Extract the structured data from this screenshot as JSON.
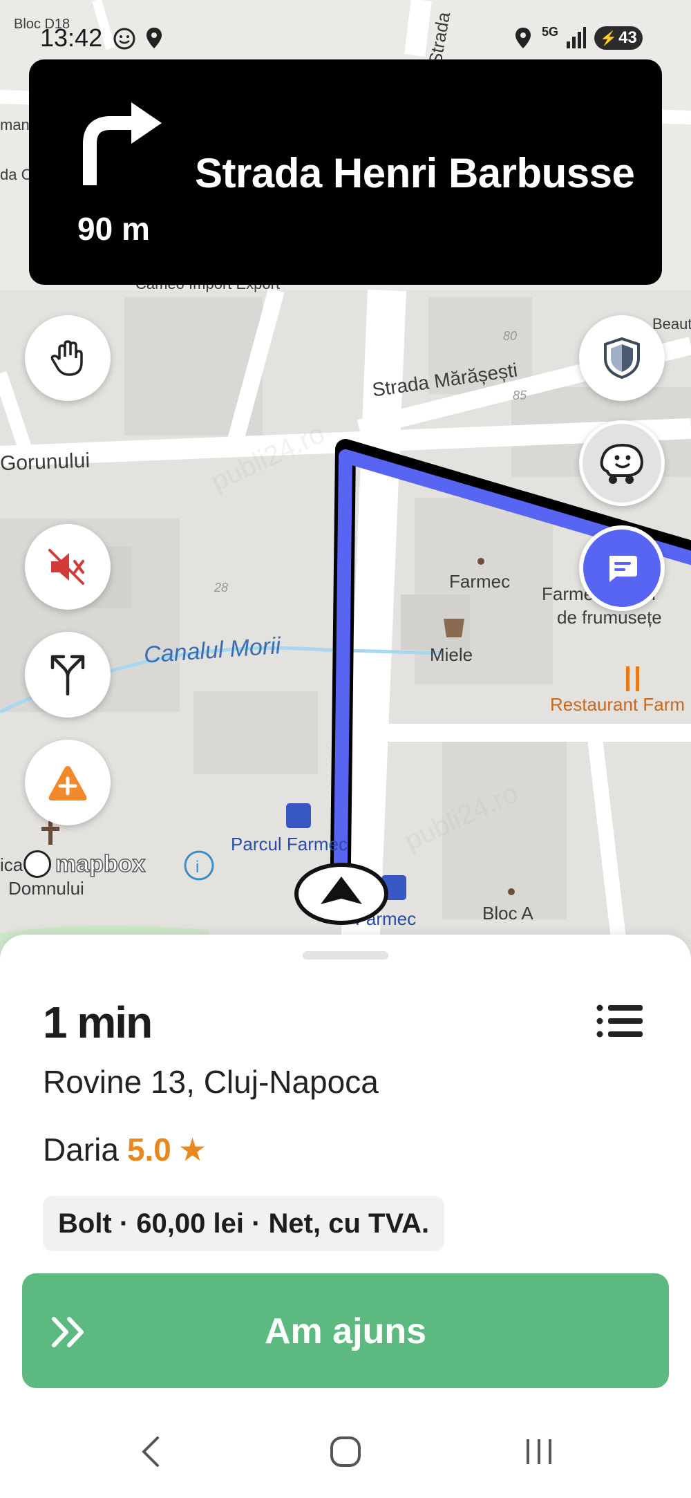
{
  "status_bar": {
    "time": "13:42",
    "network": "5G",
    "battery": "43",
    "icons": [
      "waze-face-icon",
      "location-pin-icon",
      "location-pin-icon",
      "signal-icon",
      "battery-charging-icon"
    ]
  },
  "navigation": {
    "street": "Strada Henri Barbusse",
    "distance": "90 m",
    "turn_icon": "turn-right-icon"
  },
  "map": {
    "labels": [
      "Bloc D18",
      "Strada",
      "man",
      "da C",
      "Cameo Import Export",
      "Beaut",
      "80",
      "Strada Mărășești",
      "85",
      "Gorunului",
      "Farmec",
      "Farmec Atelier",
      "de frumusețe",
      "28",
      "Canalul Morii",
      "Miele",
      "Restaurant Farm",
      "Parcul Farmec",
      "Farmec",
      "Bloc A",
      "ica",
      "Domnului",
      "mapbox"
    ],
    "buttons": {
      "report_hand": "hand-icon",
      "mute": "volume-mute-icon",
      "routes": "fork-routes-icon",
      "report_hazard": "warning-add-icon",
      "police": "shield-icon",
      "waze": "waze-face-icon",
      "chat": "chat-bubble-icon"
    },
    "accent_colors": {
      "route": "#5865f2",
      "chat": "#5865f2",
      "mute": "#d33b3b",
      "hazard": "#f0892a"
    }
  },
  "trip": {
    "eta": "1 min",
    "address": "Rovine 13, Cluj-Napoca",
    "rider_name": "Daria",
    "rating": "5.0",
    "rating_star": "★",
    "fare": "Bolt · 60,00 lei · Net, cu TVA.",
    "arrive_label": "Am ajuns",
    "arrive_color": "#5cb97f"
  },
  "watermark": "publi24.ro"
}
